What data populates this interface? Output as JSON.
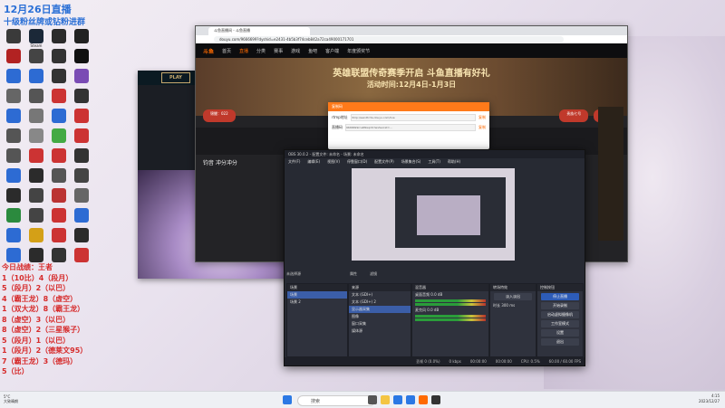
{
  "overlay": {
    "title": "12月26日直播",
    "subtitle": "十级粉丝牌或钻粉进群"
  },
  "desktop_icons": [
    {
      "label": "",
      "color": "#3a3a3a"
    },
    {
      "label": "Steam",
      "color": "#1b2838"
    },
    {
      "label": "",
      "color": "#2b2b2b"
    },
    {
      "label": "",
      "color": "#222"
    },
    {
      "label": "",
      "color": "#b22222"
    },
    {
      "label": "",
      "color": "#444"
    },
    {
      "label": "",
      "color": "#333"
    },
    {
      "label": "",
      "color": "#111"
    },
    {
      "label": "",
      "color": "#2d6bd3"
    },
    {
      "label": "",
      "color": "#2d6bd3"
    },
    {
      "label": "",
      "color": "#333"
    },
    {
      "label": "",
      "color": "#7a4cb4"
    },
    {
      "label": "",
      "color": "#666"
    },
    {
      "label": "",
      "color": "#555"
    },
    {
      "label": "",
      "color": "#c33"
    },
    {
      "label": "",
      "color": "#333"
    },
    {
      "label": "",
      "color": "#2d6bd3"
    },
    {
      "label": "",
      "color": "#777"
    },
    {
      "label": "",
      "color": "#2d6bd3"
    },
    {
      "label": "",
      "color": "#c33"
    },
    {
      "label": "",
      "color": "#555"
    },
    {
      "label": "",
      "color": "#888"
    },
    {
      "label": "",
      "color": "#4a4"
    },
    {
      "label": "",
      "color": "#c33"
    },
    {
      "label": "",
      "color": "#555"
    },
    {
      "label": "",
      "color": "#c33"
    },
    {
      "label": "",
      "color": "#c33"
    },
    {
      "label": "",
      "color": "#333"
    },
    {
      "label": "",
      "color": "#2d6bd3"
    },
    {
      "label": "",
      "color": "#2b2b2b"
    },
    {
      "label": "",
      "color": "#555"
    },
    {
      "label": "",
      "color": "#444"
    },
    {
      "label": "",
      "color": "#2b2b2b"
    },
    {
      "label": "",
      "color": "#444"
    },
    {
      "label": "",
      "color": "#b33"
    },
    {
      "label": "",
      "color": "#666"
    },
    {
      "label": "",
      "color": "#2b8a3e"
    },
    {
      "label": "",
      "color": "#444"
    },
    {
      "label": "",
      "color": "#c33"
    },
    {
      "label": "",
      "color": "#2d6bd3"
    },
    {
      "label": "",
      "color": "#2d6bd3"
    },
    {
      "label": "",
      "color": "#d4a017"
    },
    {
      "label": "",
      "color": "#c33"
    },
    {
      "label": "",
      "color": "#2b2b2b"
    },
    {
      "label": "",
      "color": "#2d6bd3"
    },
    {
      "label": "",
      "color": "#2b2b2b"
    },
    {
      "label": "",
      "color": "#333"
    },
    {
      "label": "",
      "color": "#c33"
    }
  ],
  "stats": [
    "今日战绩：王者",
    "1（10比）4（段月）",
    "5（段月）2（以巴）",
    "4（霸王龙）8（虚空）",
    "1（双大龙）8（霸王龙）",
    "8（虚空）3（以巴）",
    "8（虚空）2（三星猴子）",
    "5（段月）1（以巴）",
    "1（段月）2（德莱文95）",
    "7（霸王龙）3（德玛）",
    "5（比）"
  ],
  "browser": {
    "tab_title": "斗鱼直播间 - 斗鱼直播",
    "url": "douyu.com/9666699?dyshid=e2431-4b5b3f74ceb842a72ca49000171701",
    "nav": [
      "首页",
      "直播",
      "分类",
      "赛事",
      "游戏",
      "鱼吧",
      "客户端",
      "年度颁奖节"
    ],
    "site_logo": "斗鱼",
    "banner_title": "英雄联盟传奇赛季开启 斗鱼直播有好礼",
    "banner_date": "活动时间:12月4日-1月3日",
    "room_tags": [
      "锦鲤：022",
      "",
      "",
      "贵族七号",
      "贵宾yy"
    ],
    "streamer": "钧音  冲分冲分",
    "accent": "#ff6a00"
  },
  "dialog": {
    "title": "复制码",
    "row1_label": "rtmp地址",
    "row1_value": "rtmp://sendtc3a.douyu.com/live",
    "row2_label": "直播码",
    "row2_value": "9666699rnsRNwpYA?wsSecret=...",
    "copy": "复制"
  },
  "game": {
    "play_label": "PLAY"
  },
  "obs": {
    "title": "OBS 30.0.2 - 配置文件: 未命名 - 场景: 未命名",
    "menu": [
      "文件(F)",
      "编辑(E)",
      "视图(V)",
      "停靠窗口(D)",
      "配置文件(P)",
      "场景集合(S)",
      "工具(T)",
      "帮助(H)"
    ],
    "no_source": "未选择源",
    "properties": "属性",
    "filters": "滤镜",
    "docks": {
      "scenes": "场景",
      "sources": "来源",
      "mixer": "混音器",
      "transitions": "转场特效",
      "controls": "控制按钮"
    },
    "scene_items": [
      "场景",
      "场景 2"
    ],
    "source_items": [
      "文本 (GDI+)",
      "文本 (GDI+) 2",
      "显示器采集",
      "图像",
      "窗口采集",
      "媒体源"
    ],
    "mixer_items": [
      {
        "label": "桌面音频",
        "value": "0.0 dB"
      },
      {
        "label": "麦克风",
        "value": "0.0 dB"
      }
    ],
    "transition": "淡入淡出",
    "duration_label": "时长",
    "duration_value": "300 ms",
    "controls": [
      "停止直播",
      "开始录制",
      "启动虚拟摄像机",
      "工作室模式",
      "设置",
      "退出"
    ],
    "status": [
      "丢帧 0 (0.0%)",
      "0 kbps",
      "00:00:00",
      "00:00:00",
      "CPU: 0.5%",
      "60.00 / 60.00 FPS"
    ]
  },
  "taskbar": {
    "weather_temp": "5°C",
    "weather_text": "大致晴朗",
    "search_placeholder": "搜索",
    "time": "4:15",
    "date": "2023/12/27"
  }
}
